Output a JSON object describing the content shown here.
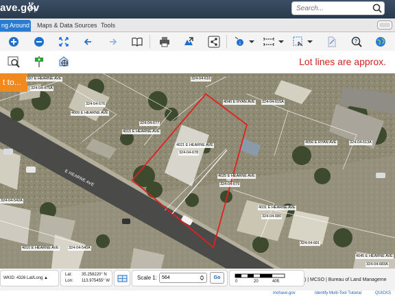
{
  "header": {
    "logo_text": "ave.gov",
    "search_placeholder": "Search..."
  },
  "tabs": [
    {
      "label": "ng Around"
    },
    {
      "label": "Maps & Data Sources"
    },
    {
      "label": "Tools"
    }
  ],
  "notice": "Lot lines are approx.",
  "map": {
    "partial_button": "t to...",
    "road_label": "E HEARNE AVE",
    "parcels": [
      {
        "text": "097 E HEARNE AVE"
      },
      {
        "text": "324-04-475A"
      },
      {
        "text": "324-04-676"
      },
      {
        "text": "4009 E HEARNE AVE"
      },
      {
        "text": "324-04-677"
      },
      {
        "text": "4015 E HEARNE AVE"
      },
      {
        "text": "4040 E RYAN AVE"
      },
      {
        "text": "324-04-615A"
      },
      {
        "text": "4021 E HEARNE AVE"
      },
      {
        "text": "324-04-678"
      },
      {
        "text": "4025 E HEARNE AVE"
      },
      {
        "text": "324-04-679"
      },
      {
        "text": "4056 E RYAN AVE"
      },
      {
        "text": "324-04-613A"
      },
      {
        "text": "4031 E HEARNE AVE"
      },
      {
        "text": "324-04-680"
      },
      {
        "text": "324-04-616"
      },
      {
        "text": "324-04-542A"
      },
      {
        "text": "4010 E HEARNE AVE"
      },
      {
        "text": "324-04-540A"
      },
      {
        "text": "324-04-681"
      },
      {
        "text": "4045 E HEARNE AVE"
      },
      {
        "text": "324-04-683A"
      }
    ]
  },
  "status": {
    "wkid": "WKID: 4326 Lat/Long ▲",
    "lat_label": "Lat:",
    "lat_value": "35.258220° N",
    "lon_label": "Lon:",
    "lon_value": "113.975455° W",
    "scale_label": "Scale 1:",
    "scale_value": "564",
    "go_label": "Go",
    "scalebar_0": "0",
    "scalebar_20": "20",
    "scalebar_40": "40ft",
    "credits": ") | MCSO | Bureau of Land Manageme"
  },
  "footer": {
    "site": "mohave.gov",
    "tutorial": "Identify Multi-Tool Tutorial",
    "quick": "QUICKS"
  },
  "colors": {
    "accent_tab": "#2a7cd2",
    "lot_note": "#d4231f",
    "parcel_outline": "#e02020",
    "orange": "#f08a1f"
  }
}
